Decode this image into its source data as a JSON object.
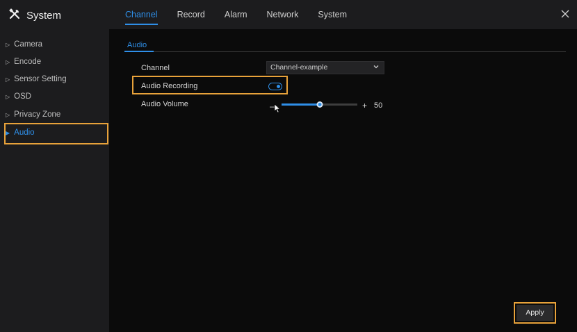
{
  "app": {
    "title": "System"
  },
  "tabs": [
    {
      "label": "Channel",
      "active": true
    },
    {
      "label": "Record"
    },
    {
      "label": "Alarm"
    },
    {
      "label": "Network"
    },
    {
      "label": "System"
    }
  ],
  "sidebar": {
    "items": [
      {
        "label": "Camera"
      },
      {
        "label": "Encode"
      },
      {
        "label": "Sensor Setting"
      },
      {
        "label": "OSD"
      },
      {
        "label": "Privacy Zone"
      },
      {
        "label": "Audio",
        "active": true
      }
    ]
  },
  "section": {
    "tab_label": "Audio"
  },
  "form": {
    "channel": {
      "label": "Channel",
      "value": "Channel-example"
    },
    "audio_recording": {
      "label": "Audio Recording",
      "enabled": true
    },
    "audio_volume": {
      "label": "Audio Volume",
      "minus": "—",
      "plus": "+",
      "value": "50",
      "level_percent": 50
    }
  },
  "footer": {
    "apply_label": "Apply"
  },
  "colors": {
    "accent": "#2f8fe8",
    "highlight": "#e8a23a",
    "panel": "#1c1c1e",
    "background": "#0b0b0b"
  }
}
